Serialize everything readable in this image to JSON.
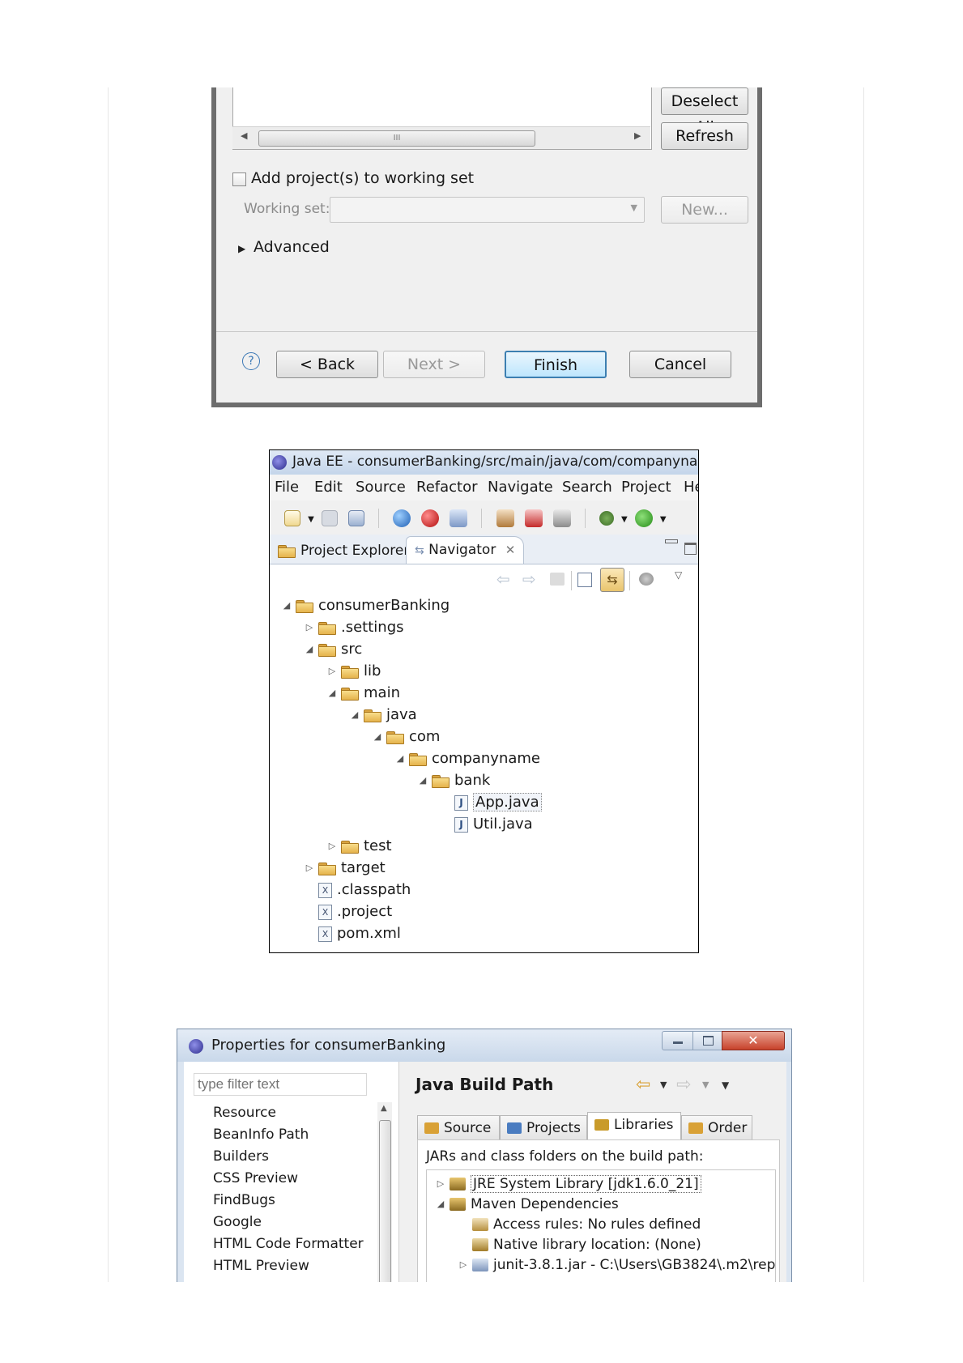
{
  "wizard": {
    "deselect_all": "Deselect All",
    "refresh": "Refresh",
    "scroll_thumb": "III",
    "add_to_working_set": "Add project(s) to working set",
    "working_set_label": "Working set:",
    "new_button": "New...",
    "advanced": "Advanced",
    "back": "< Back",
    "next": "Next >",
    "finish": "Finish",
    "cancel": "Cancel",
    "help": "?"
  },
  "eclipse": {
    "title": "Java EE - consumerBanking/src/main/java/com/companyname",
    "menu": [
      "File",
      "Edit",
      "Source",
      "Refactor",
      "Navigate",
      "Search",
      "Project",
      "He"
    ],
    "tabs": {
      "project_explorer": "Project Explorer",
      "navigator": "Navigator"
    },
    "tree": [
      {
        "label": "consumerBanking",
        "depth": 0,
        "toggle": "open",
        "icon": "project"
      },
      {
        "label": ".settings",
        "depth": 1,
        "toggle": "closed",
        "icon": "folder"
      },
      {
        "label": "src",
        "depth": 1,
        "toggle": "open",
        "icon": "folder"
      },
      {
        "label": "lib",
        "depth": 2,
        "toggle": "closed",
        "icon": "folder"
      },
      {
        "label": "main",
        "depth": 2,
        "toggle": "open",
        "icon": "folder"
      },
      {
        "label": "java",
        "depth": 3,
        "toggle": "open",
        "icon": "folder"
      },
      {
        "label": "com",
        "depth": 4,
        "toggle": "open",
        "icon": "folder"
      },
      {
        "label": "companyname",
        "depth": 5,
        "toggle": "open",
        "icon": "folder"
      },
      {
        "label": "bank",
        "depth": 6,
        "toggle": "open",
        "icon": "folder"
      },
      {
        "label": "App.java",
        "depth": 7,
        "toggle": "none",
        "icon": "java"
      },
      {
        "label": "Util.java",
        "depth": 7,
        "toggle": "none",
        "icon": "java"
      },
      {
        "label": "test",
        "depth": 2,
        "toggle": "closed",
        "icon": "folder"
      },
      {
        "label": "target",
        "depth": 1,
        "toggle": "closed",
        "icon": "folder"
      },
      {
        "label": ".classpath",
        "depth": 1,
        "toggle": "none",
        "icon": "xml"
      },
      {
        "label": ".project",
        "depth": 1,
        "toggle": "none",
        "icon": "xml"
      },
      {
        "label": "pom.xml",
        "depth": 1,
        "toggle": "none",
        "icon": "xml"
      }
    ]
  },
  "properties": {
    "title": "Properties for consumerBanking",
    "filter_placeholder": "type filter text",
    "nav_items": [
      "Resource",
      "BeanInfo Path",
      "Builders",
      "CSS Preview",
      "FindBugs",
      "Google",
      "HTML Code Formatter",
      "HTML Preview"
    ],
    "heading": "Java Build Path",
    "tabs": [
      "Source",
      "Projects",
      "Libraries",
      "Order"
    ],
    "selected_tab": "Libraries",
    "jars_label": "JARs and class folders on the build path:",
    "libs": [
      {
        "label": "JRE System Library [jdk1.6.0_21]",
        "depth": 0,
        "toggle": "closed"
      },
      {
        "label": "Maven Dependencies",
        "depth": 0,
        "toggle": "open"
      },
      {
        "label": "Access rules: No rules defined",
        "depth": 1,
        "toggle": "none"
      },
      {
        "label": "Native library location: (None)",
        "depth": 1,
        "toggle": "none"
      },
      {
        "label": "junit-3.8.1.jar - C:\\Users\\GB3824\\.m2\\rep",
        "depth": 1,
        "toggle": "closed"
      }
    ]
  }
}
